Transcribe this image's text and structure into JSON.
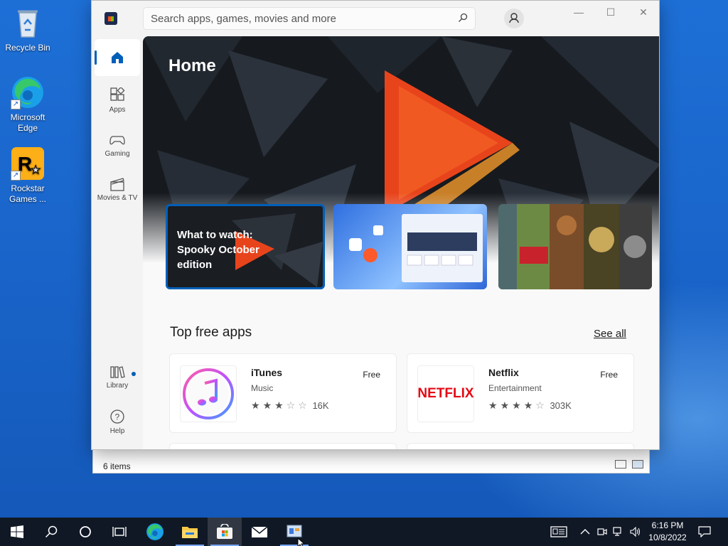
{
  "desktop": {
    "icons": [
      {
        "label": "Recycle Bin",
        "icon": "recycle-bin-icon"
      },
      {
        "label": "Microsoft Edge",
        "icon": "edge-icon"
      },
      {
        "label": "Rockstar Games ...",
        "icon": "rockstar-icon"
      }
    ]
  },
  "explorer": {
    "status": "6 items"
  },
  "store": {
    "search_placeholder": "Search apps, games, movies and more",
    "sidebar": {
      "items": [
        {
          "label": "",
          "icon": "home-icon"
        },
        {
          "label": "Apps",
          "icon": "apps-icon"
        },
        {
          "label": "Gaming",
          "icon": "gamepad-icon"
        },
        {
          "label": "Movies & TV",
          "icon": "clapperboard-icon"
        },
        {
          "label": "Library",
          "icon": "library-icon"
        },
        {
          "label": "Help",
          "icon": "help-icon"
        }
      ]
    },
    "hero": {
      "title": "Home",
      "card1_text": "What to watch: Spooky October edition"
    },
    "top_free": {
      "title": "Top free apps",
      "see_all": "See all",
      "apps": [
        {
          "name": "iTunes",
          "category": "Music",
          "price": "Free",
          "rating": 3,
          "reviews": "16K"
        },
        {
          "name": "Netflix",
          "category": "Entertainment",
          "price": "Free",
          "rating": 4,
          "reviews": "303K"
        }
      ],
      "netflix_logo": "NETFLIX"
    }
  },
  "taskbar": {
    "time": "6:16 PM",
    "date": "10/8/2022"
  },
  "colors": {
    "accent": "#005fb8",
    "desktop": "#1a66cc",
    "taskbar": "#101826",
    "netflix": "#e50914"
  }
}
